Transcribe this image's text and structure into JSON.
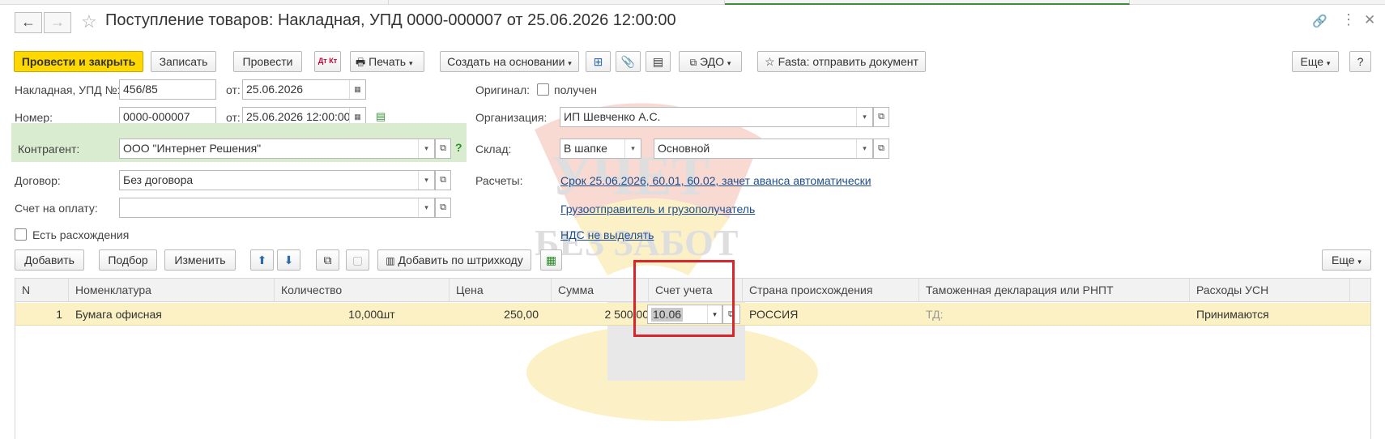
{
  "window": {
    "title": "Поступление товаров: Накладная, УПД 0000-000007 от 25.06.2026 12:00:00",
    "nav_back": "←",
    "nav_forward": "→",
    "star": "☆",
    "link_icon": "🔗",
    "more_icon": "⋮",
    "close_icon": "✕"
  },
  "toolbar": {
    "post_close": "Провести и закрыть",
    "save": "Записать",
    "post": "Провести",
    "dtkt": "Дт Кт",
    "print": "Печать",
    "create_based": "Создать на основании",
    "edo": "ЭДО",
    "fasta": "Fasta: отправить документ",
    "more": "Еще",
    "help": "?"
  },
  "form": {
    "invoice_label": "Накладная, УПД №:",
    "invoice_value": "456/85",
    "from_label": "от:",
    "invoice_date": "25.06.2026",
    "number_label": "Номер:",
    "number_value": "0000-000007",
    "number_date": "25.06.2026 12:00:00",
    "counterparty_label": "Контрагент:",
    "counterparty_value": "ООО \"Интернет Решения\"",
    "contract_label": "Договор:",
    "contract_value": "Без договора",
    "invoice_pay_label": "Счет на оплату:",
    "invoice_pay_value": "",
    "discrepancy_label": "Есть расхождения",
    "original_label": "Оригинал:",
    "original_received": "получен",
    "org_label": "Организация:",
    "org_value": "ИП Шевченко А.С.",
    "warehouse_label": "Склад:",
    "warehouse_mode": "В шапке",
    "warehouse_value": "Основной",
    "settlements_label": "Расчеты:",
    "settlements_link": "Срок 25.06.2026, 60.01, 60.02, зачет аванса автоматически",
    "shipper_link": "Грузоотправитель и грузополучатель",
    "vat_link": "НДС не выделять"
  },
  "table_toolbar": {
    "add": "Добавить",
    "pick": "Подбор",
    "change": "Изменить",
    "barcode": "Добавить по штрихкоду",
    "more": "Еще"
  },
  "table": {
    "headers": {
      "n": "N",
      "item": "Номенклатура",
      "qty": "Количество",
      "price": "Цена",
      "sum": "Сумма",
      "account": "Счет учета",
      "country": "Страна происхождения",
      "customs": "Таможенная декларация или РНПТ",
      "usn": "Расходы УСН"
    },
    "rows": [
      {
        "n": "1",
        "item": "Бумага офисная",
        "qty": "10,000",
        "unit": "шт",
        "price": "250,00",
        "sum": "2 500,00",
        "account": "10.06",
        "country": "РОССИЯ",
        "customs": "ТД:",
        "usn": "Принимаются"
      }
    ]
  },
  "watermark": {
    "line1": "УЧЕТ",
    "line2": "БЕЗ ЗАБОТ"
  },
  "colors": {
    "primary": "#ffd800",
    "counterparty_bg": "#d9ecd0",
    "row_highlight": "#fbf1c4",
    "highlight_box": "#d9262c",
    "link": "#1f4e8c"
  }
}
